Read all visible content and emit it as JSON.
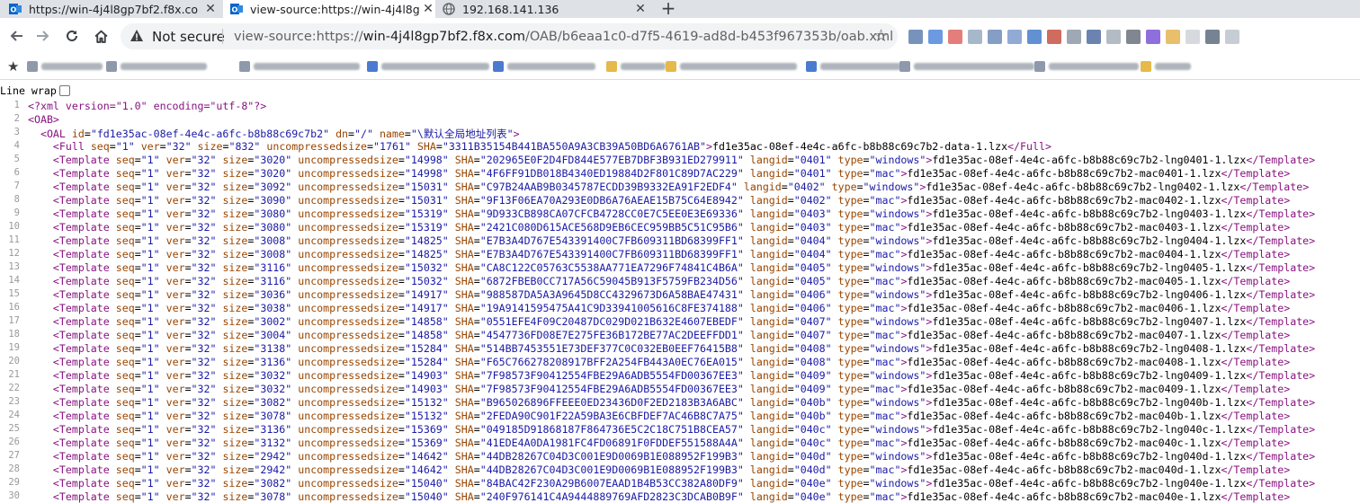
{
  "browser": {
    "tabs": [
      {
        "title": "https://win-4j4l8gp7bf2.f8x.co",
        "favicon": "outlook-icon",
        "active": false
      },
      {
        "title": "view-source:https://win-4j4l8g",
        "favicon": "outlook-icon",
        "active": true
      },
      {
        "title": "192.168.141.136",
        "favicon": "globe-icon",
        "active": false
      }
    ],
    "new_tab": "+",
    "not_secure": "Not secure",
    "url_prefix": "view-source:https://",
    "url_host": "win-4j4l8gp7bf2.f8x.com",
    "url_path": "/OAB/b6eaa1c0-d7f5-4619-ad8d-b453f967353b/oab.xml"
  },
  "colors": {
    "tag": "#881280",
    "attr_name": "#994500",
    "attr_value": "#1a1aa6",
    "line_number": "#999999",
    "tabstrip": "#dee1e6"
  },
  "source": {
    "line_wrap_label": "Line wrap",
    "line_wrap_checked": false,
    "declaration": "<?xml version=\"1.0\" encoding=\"utf-8\"?>",
    "oab_open": "<OAB>",
    "oal": {
      "id": "fd1e35ac-08ef-4e4c-a6fc-b8b88c69c7b2",
      "dn": "/",
      "name": "\\默认全局地址列表"
    },
    "full": {
      "seq": "1",
      "ver": "32",
      "size": "832",
      "uncompressedsize": "1761",
      "SHA": "3311B35154B441BA550A9A3CB39A50BD6A6761AB",
      "file": "fd1e35ac-08ef-4e4c-a6fc-b8b88c69c7b2-data-1.lzx"
    },
    "template_prefix": "fd1e35ac-08ef-4e4c-a6fc-b8b88c69c7b2-",
    "templates": [
      {
        "size": "3020",
        "uncompressedsize": "14998",
        "SHA": "202965E0F2D4FD844E577EB7DBF3B931ED279911",
        "langid": "0401",
        "type": "windows"
      },
      {
        "size": "3020",
        "uncompressedsize": "14998",
        "SHA": "4F6FF91DB018B4340ED19884D2F801C89D7AC229",
        "langid": "0401",
        "type": "mac"
      },
      {
        "size": "3092",
        "uncompressedsize": "15031",
        "SHA": "C97B24AAB9B0345787ECDD39B9332EA91F2EDF4",
        "langid": "0402",
        "type": "windows"
      },
      {
        "size": "3090",
        "uncompressedsize": "15031",
        "SHA": "9F13F06EA70A293E0DB6A76AEAE15B75C64E8942",
        "langid": "0402",
        "type": "mac"
      },
      {
        "size": "3080",
        "uncompressedsize": "15319",
        "SHA": "9D933CB898CA07CFCB4728CC0E7C5EE0E3E69336",
        "langid": "0403",
        "type": "windows"
      },
      {
        "size": "3080",
        "uncompressedsize": "15319",
        "SHA": "2421C080D615ACE568D9EB6CEC959BB5C51C95B6",
        "langid": "0403",
        "type": "mac"
      },
      {
        "size": "3008",
        "uncompressedsize": "14825",
        "SHA": "E7B3A4D767E543391400C7FB609311BD68399FF1",
        "langid": "0404",
        "type": "windows"
      },
      {
        "size": "3008",
        "uncompressedsize": "14825",
        "SHA": "E7B3A4D767E543391400C7FB609311BD68399FF1",
        "langid": "0404",
        "type": "mac"
      },
      {
        "size": "3116",
        "uncompressedsize": "15032",
        "SHA": "CA8C122C05763C5538AA771EA7296F74841C4B6A",
        "langid": "0405",
        "type": "windows"
      },
      {
        "size": "3116",
        "uncompressedsize": "15032",
        "SHA": "6872FBEB0CC717A56C59045B913F5759FB234D56",
        "langid": "0405",
        "type": "mac"
      },
      {
        "size": "3036",
        "uncompressedsize": "14917",
        "SHA": "988587DA5A3A9645D8CC4329673D6A58BAE47431",
        "langid": "0406",
        "type": "windows"
      },
      {
        "size": "3038",
        "uncompressedsize": "14917",
        "SHA": "19A9141595475A41C9D33941005616C8FE374188",
        "langid": "0406",
        "type": "mac"
      },
      {
        "size": "3002",
        "uncompressedsize": "14858",
        "SHA": "0551EFE4F09C20487DC029D021B632E4607EBEDF",
        "langid": "0407",
        "type": "windows"
      },
      {
        "size": "3004",
        "uncompressedsize": "14858",
        "SHA": "4547736FD08E7E275FE36B172BE77AC2DEEFFDD1",
        "langid": "0407",
        "type": "mac"
      },
      {
        "size": "3138",
        "uncompressedsize": "15284",
        "SHA": "514BB7453551E73DEF377C0C032EB0EEF76415B8",
        "langid": "0408",
        "type": "windows"
      },
      {
        "size": "3136",
        "uncompressedsize": "15284",
        "SHA": "F65C766278208917BFF2A254FB443A0EC76EA015",
        "langid": "0408",
        "type": "mac"
      },
      {
        "size": "3032",
        "uncompressedsize": "14903",
        "SHA": "7F98573F90412554FBE29A6ADB5554FD00367EE3",
        "langid": "0409",
        "type": "windows"
      },
      {
        "size": "3032",
        "uncompressedsize": "14903",
        "SHA": "7F98573F90412554FBE29A6ADB5554FD00367EE3",
        "langid": "0409",
        "type": "mac"
      },
      {
        "size": "3082",
        "uncompressedsize": "15132",
        "SHA": "B965026896FFEEE0ED23436D0F2ED2183B3A6ABC",
        "langid": "040b",
        "type": "windows"
      },
      {
        "size": "3078",
        "uncompressedsize": "15132",
        "SHA": "2FEDA90C901F22A59BA3E6CBFDEF7AC46B8C7A75",
        "langid": "040b",
        "type": "mac"
      },
      {
        "size": "3136",
        "uncompressedsize": "15369",
        "SHA": "049185D91868187F864736E5C2C18C751B8CEA57",
        "langid": "040c",
        "type": "windows"
      },
      {
        "size": "3132",
        "uncompressedsize": "15369",
        "SHA": "41EDE4A0DA1981FC4FD06891F0FDDEF551588A4A",
        "langid": "040c",
        "type": "mac"
      },
      {
        "size": "2942",
        "uncompressedsize": "14642",
        "SHA": "44DB28267C04D3C001E9D0069B1E088952F199B3",
        "langid": "040d",
        "type": "windows"
      },
      {
        "size": "2942",
        "uncompressedsize": "14642",
        "SHA": "44DB28267C04D3C001E9D0069B1E088952F199B3",
        "langid": "040d",
        "type": "mac"
      },
      {
        "size": "3082",
        "uncompressedsize": "15040",
        "SHA": "84BAC42F230A29B6007EAAD1B4B53CC382A80DF9",
        "langid": "040e",
        "type": "windows"
      },
      {
        "size": "3078",
        "uncompressedsize": "15040",
        "SHA": "240F976141C4A9444889769AFD2823C3DCAB0B9F",
        "langid": "040e",
        "type": "mac"
      }
    ]
  }
}
